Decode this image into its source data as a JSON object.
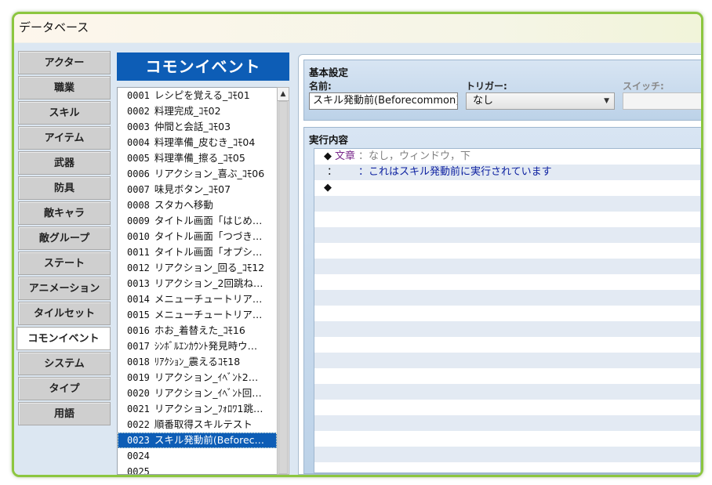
{
  "window": {
    "title": "データベース"
  },
  "tabs": [
    {
      "label": "アクター",
      "active": false
    },
    {
      "label": "職業",
      "active": false
    },
    {
      "label": "スキル",
      "active": false
    },
    {
      "label": "アイテム",
      "active": false
    },
    {
      "label": "武器",
      "active": false
    },
    {
      "label": "防具",
      "active": false
    },
    {
      "label": "敵キャラ",
      "active": false
    },
    {
      "label": "敵グループ",
      "active": false
    },
    {
      "label": "ステート",
      "active": false
    },
    {
      "label": "アニメーション",
      "active": false
    },
    {
      "label": "タイルセット",
      "active": false
    },
    {
      "label": "コモンイベント",
      "active": true
    },
    {
      "label": "システム",
      "active": false
    },
    {
      "label": "タイプ",
      "active": false
    },
    {
      "label": "用語",
      "active": false
    }
  ],
  "list": {
    "header": "コモンイベント",
    "items": [
      {
        "num": "0001",
        "name": "レシピを覚える_ｺﾓ01"
      },
      {
        "num": "0002",
        "name": "料理完成_ｺﾓ02"
      },
      {
        "num": "0003",
        "name": "仲間と会話_ｺﾓ03"
      },
      {
        "num": "0004",
        "name": "料理準備_皮むき_ｺﾓ04"
      },
      {
        "num": "0005",
        "name": "料理準備_擦る_ｺﾓ05"
      },
      {
        "num": "0006",
        "name": "リアクション_喜ぶ_ｺﾓ06"
      },
      {
        "num": "0007",
        "name": "味見ボタン_ｺﾓ07"
      },
      {
        "num": "0008",
        "name": "スタカへ移動"
      },
      {
        "num": "0009",
        "name": "タイトル画面「はじめ…"
      },
      {
        "num": "0010",
        "name": "タイトル画面「つづき…"
      },
      {
        "num": "0011",
        "name": "タイトル画面「オプシ…"
      },
      {
        "num": "0012",
        "name": "リアクション_回る_ｺﾓ12"
      },
      {
        "num": "0013",
        "name": "リアクション_2回跳ね…"
      },
      {
        "num": "0014",
        "name": "メニューチュートリア…"
      },
      {
        "num": "0015",
        "name": "メニューチュートリア…"
      },
      {
        "num": "0016",
        "name": "ホお_着替えた_ｺﾓ16"
      },
      {
        "num": "0017",
        "name": "ｼﾝﾎﾞﾙｴﾝｶｳﾝﾄ発見時ウ…"
      },
      {
        "num": "0018",
        "name": "ﾘｱｸｼｮﾝ_震えるｺﾓ18"
      },
      {
        "num": "0019",
        "name": "リアクション_ｲﾍﾞﾝﾄ2…"
      },
      {
        "num": "0020",
        "name": "リアクション_ｲﾍﾞﾝﾄ回…"
      },
      {
        "num": "0021",
        "name": "リアクション_ﾌｫﾛﾜ1跳…"
      },
      {
        "num": "0022",
        "name": "順番取得スキルテスト"
      },
      {
        "num": "0023",
        "name": "スキル発動前(Beforec…",
        "selected": true
      },
      {
        "num": "0024",
        "name": ""
      },
      {
        "num": "0025",
        "name": ""
      }
    ]
  },
  "basic": {
    "title": "基本設定",
    "name_label": "名前:",
    "name_value": "スキル発動前(Beforecommon)",
    "trigger_label": "トリガー:",
    "trigger_value": "なし",
    "switch_label": "スイッチ:",
    "switch_value": ""
  },
  "exec": {
    "title": "実行内容",
    "commands": [
      {
        "diamond": "◆",
        "name": "文章",
        "params": "：なし，ウィンドウ，下"
      },
      {
        "colon": "：",
        "content": "：これはスキル発動前に実行されています"
      },
      {
        "diamond": "◆"
      }
    ]
  }
}
